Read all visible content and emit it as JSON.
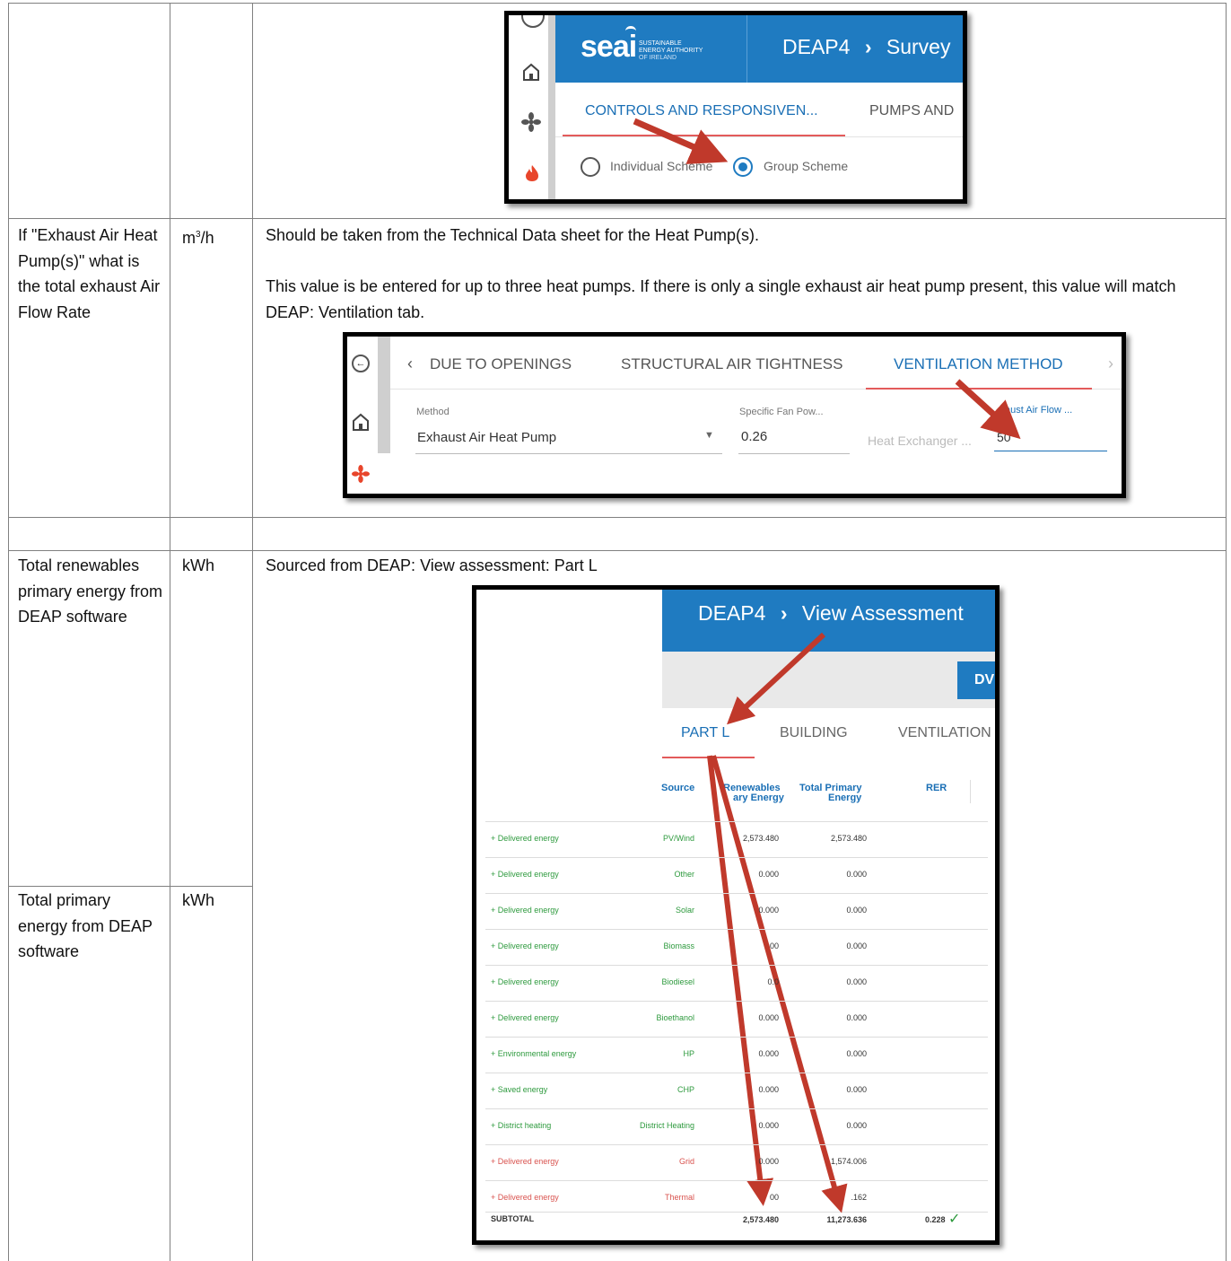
{
  "rows": {
    "exhaust": {
      "label": "If \"Exhaust Air Heat Pump(s)\" what is the total exhaust Air Flow Rate",
      "unit_base": "m",
      "unit_sup": "3",
      "unit_rest": "/h",
      "desc1": "Should be taken from the Technical Data sheet for the Heat Pump(s).",
      "desc2": "This value is be entered for up to three heat pumps. If there is only a single exhaust air heat pump present, this value will match DEAP: Ventilation tab."
    },
    "renewables": {
      "label": "Total renewables primary energy from DEAP software",
      "unit": "kWh",
      "desc": "Sourced from DEAP: View assessment: Part L"
    },
    "primary": {
      "label": "Total primary energy from DEAP software",
      "unit": "kWh"
    }
  },
  "shot1": {
    "logo": "seai",
    "logo_sub1": "SUSTAINABLE",
    "logo_sub2": "ENERGY AUTHORITY",
    "logo_sub3": "OF IRELAND",
    "breadcrumb_app": "DEAP4",
    "breadcrumb_sep": "›",
    "breadcrumb_page": "Survey",
    "tab_active": "CONTROLS AND RESPONSIVEN...",
    "tab_next": "PUMPS AND",
    "radio1": "Individual Scheme",
    "radio2": "Group Scheme",
    "colors": {
      "header": "#1f7bc1",
      "accent": "#1a6fb5",
      "arrow": "#c0392b"
    }
  },
  "shot2": {
    "tab1": "DUE TO OPENINGS",
    "tab2": "STRUCTURAL AIR TIGHTNESS",
    "tab3": "VENTILATION METHOD",
    "method_label": "Method",
    "method_value": "Exhaust Air Heat Pump",
    "sfp_label": "Specific Fan Pow...",
    "sfp_value": "0.26",
    "hx_label": "Heat Exchanger ...",
    "flow_label": "aust Air Flow ...",
    "flow_value": "50"
  },
  "shot3": {
    "breadcrumb_app": "DEAP4",
    "breadcrumb_sep": "›",
    "breadcrumb_page": "View Assessment",
    "button_partial": "DV",
    "tab_active": "PART L",
    "tab2": "BUILDING",
    "tab3": "VENTILATION",
    "col_source": "Source",
    "col_renewables_1": "Renewables",
    "col_renewables_2": "ary Energy",
    "col_total_1": "Total Primary",
    "col_total_2": "Energy",
    "col_rer": "RER",
    "table": [
      {
        "label": "+ Delivered energy",
        "source": "PV/Wind",
        "renew": "2,573.480",
        "total": "2,573.480",
        "red": false
      },
      {
        "label": "+ Delivered energy",
        "source": "Other",
        "renew": "0.000",
        "total": "0.000",
        "red": false
      },
      {
        "label": "+ Delivered energy",
        "source": "Solar",
        "renew": "0.000",
        "total": "0.000",
        "red": false
      },
      {
        "label": "+ Delivered energy",
        "source": "Biomass",
        "renew": "00",
        "total": "0.000",
        "red": false
      },
      {
        "label": "+ Delivered energy",
        "source": "Biodiesel",
        "renew": "0.0",
        "total": "0.000",
        "red": false
      },
      {
        "label": "+ Delivered energy",
        "source": "Bioethanol",
        "renew": "0.000",
        "total": "0.000",
        "red": false
      },
      {
        "label": "+ Environmental energy",
        "source": "HP",
        "renew": "0.000",
        "total": "0.000",
        "red": false
      },
      {
        "label": "+ Saved energy",
        "source": "CHP",
        "renew": "0.000",
        "total": "0.000",
        "red": false
      },
      {
        "label": "+ District heating",
        "source": "District Heating",
        "renew": "0.000",
        "total": "0.000",
        "red": false
      },
      {
        "label": "+ Delivered energy",
        "source": "Grid",
        "renew": "0.000",
        "total": "1,574.006",
        "red": true
      },
      {
        "label": "+ Delivered energy",
        "source": "Thermal",
        "renew": "00",
        "total": ".162",
        "red": true
      }
    ],
    "subtotal_label": "SUBTOTAL",
    "subtotal_renew": "2,573.480",
    "subtotal_total": "11,273.636",
    "subtotal_rer": "0.228"
  }
}
